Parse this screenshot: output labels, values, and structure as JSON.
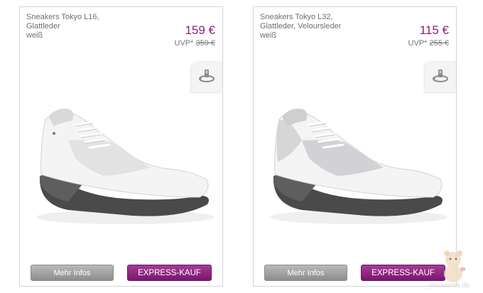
{
  "products": [
    {
      "name_line1": "Sneakers Tokyo L16,",
      "name_line2": "Glattleder",
      "color": "weiß",
      "price": "159 €",
      "uvp_label": "UVP*",
      "uvp_old": "359 €",
      "more_info_label": "Mehr Infos",
      "express_label": "EXPRESS-KAUF",
      "icon": "rotate-360-icon",
      "image": "white-sneaker-glattleder"
    },
    {
      "name_line1": "Sneakers Tokyo L32,",
      "name_line2": "Glattleder, Veloursleder",
      "color": "weiß",
      "price": "115 €",
      "uvp_label": "UVP*",
      "uvp_old": "255 €",
      "more_info_label": "Mehr Infos",
      "express_label": "EXPRESS-KAUF",
      "icon": "rotate-360-icon",
      "image": "white-sneaker-veloursleder"
    }
  ],
  "colors": {
    "price": "#8a1e7c",
    "express_button": "#8b1f7e",
    "info_button": "#a3a3a3",
    "text": "#6e6e6e"
  },
  "watermark": {
    "text": "yousanna.de",
    "icon": "teddy-bear-icon"
  }
}
